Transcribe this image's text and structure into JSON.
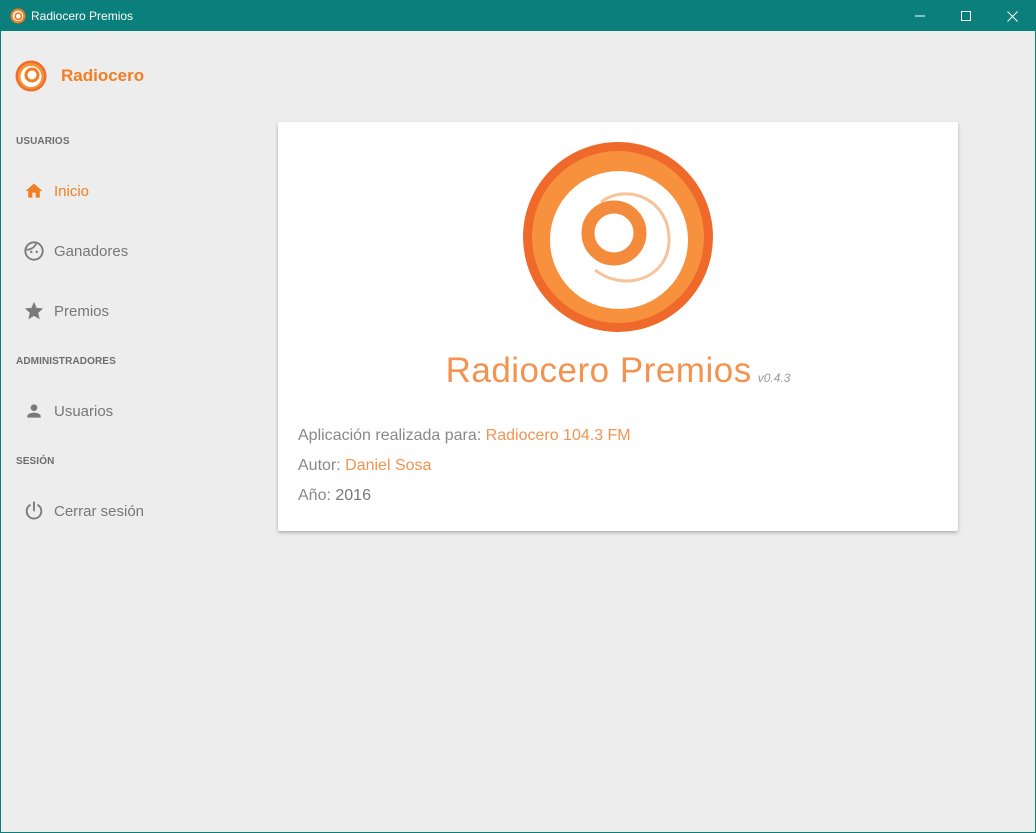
{
  "window": {
    "title": "Radiocero Premios",
    "controls": {
      "minimize": "minimize-icon",
      "maximize": "maximize-icon",
      "close": "close-icon"
    }
  },
  "sidebar": {
    "brand": "Radiocero",
    "sections": [
      {
        "label": "USUARIOS"
      },
      {
        "label": "ADMINISTRADORES"
      },
      {
        "label": "SESIÓN"
      }
    ],
    "items": [
      {
        "label": "Inicio",
        "icon": "home-icon",
        "active": true
      },
      {
        "label": "Ganadores",
        "icon": "face-icon",
        "active": false
      },
      {
        "label": "Premios",
        "icon": "star-icon",
        "active": false
      },
      {
        "label": "Usuarios",
        "icon": "person-icon",
        "active": false
      },
      {
        "label": "Cerrar sesión",
        "icon": "power-icon",
        "active": false
      }
    ]
  },
  "about": {
    "app_name": "Radiocero Premios",
    "version": "v0.4.3",
    "made_for_label": "Aplicación realizada para:",
    "made_for_value": "Radiocero 104.3 FM",
    "author_label": "Autor:",
    "author_value": "Daniel Sosa",
    "year_label": "Año:",
    "year_value": "2016"
  },
  "colors": {
    "accent": "#f07f23",
    "titlebar": "#0a7f7b",
    "background": "#ededed",
    "muted_text": "#777777"
  }
}
